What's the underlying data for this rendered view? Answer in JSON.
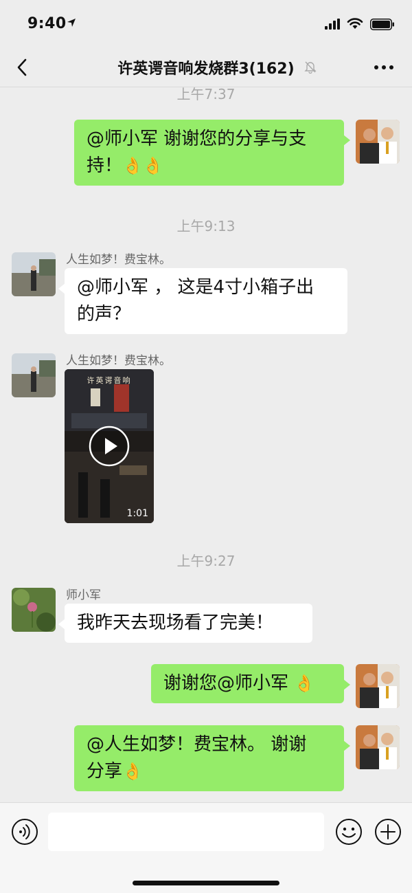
{
  "status_bar": {
    "time": "9:40"
  },
  "nav": {
    "title": "许英谔音响发烧群3(162)"
  },
  "messages": {
    "ts0": "上午7:37",
    "m1_line1": "@师小军 谢谢您的分享与支",
    "m1_line2": "持！",
    "m1_emoji": "👌👌",
    "ts1": "上午9:13",
    "m2_sender": "人生如梦！费宝林。",
    "m2_line1": "@师小军 ， 这是4寸小箱子出",
    "m2_line2": "的声？",
    "m3_sender": "人生如梦！费宝林。",
    "m3_video_sign": "许英谔音响",
    "m3_video_duration": "1:01",
    "ts2": "上午9:27",
    "m4_sender": "师小军",
    "m4_text": "我昨天去现场看了完美！",
    "m5_text": "谢谢您@师小军 ",
    "m5_emoji": "👌",
    "m6_line1": "@人生如梦！费宝林。 谢谢",
    "m6_line2": "分享",
    "m6_emoji": "👌"
  },
  "input": {
    "placeholder": ""
  },
  "icons": {
    "back": "chevron-left-icon",
    "mute": "bell-slash-icon",
    "more": "more-dots-icon",
    "voice": "voice-icon",
    "emoji": "smiley-icon",
    "plus": "plus-circle-icon",
    "play": "play-icon"
  },
  "colors": {
    "outgoing_bubble": "#95ec69",
    "incoming_bubble": "#ffffff",
    "background": "#ededed"
  }
}
